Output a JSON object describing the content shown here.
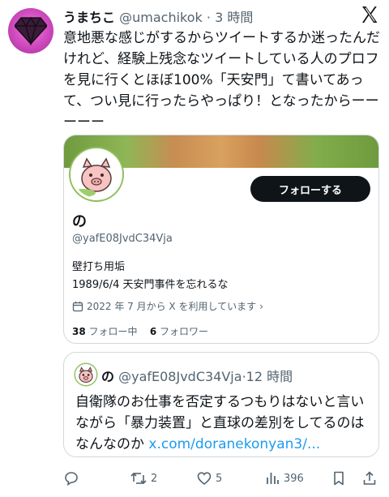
{
  "author": {
    "name": "うまちこ",
    "handle": "@umachikok",
    "dot": "·",
    "time": "3 時間"
  },
  "icons": {
    "platform": "x-logo-icon",
    "avatar": "diamond-icon",
    "calendar": "calendar-icon",
    "reply": "reply-icon",
    "retweet": "retweet-icon",
    "like": "heart-icon",
    "views": "views-icon",
    "bookmark": "bookmark-icon",
    "share": "share-icon"
  },
  "tweet": {
    "text": "意地悪な感じがするからツイートするか迷ったんだけれど、経験上残念なツイートしている人のプロフを見に行くとほぼ100%「天安門」て書いてあって、つい見に行ったらやっぱり！となったからーーーーー"
  },
  "profile_card": {
    "follow_label": "フォローする",
    "name": "の",
    "handle": "@yafE08JvdC34Vja",
    "bio": "壁打ち用垢\n1989/6/4 天安門事件を忘れるな",
    "joined": "2022 年 7 月から X を利用しています",
    "joined_chevron": "›",
    "following_count": "38",
    "following_label": "フォロー中",
    "followers_count": "6",
    "followers_label": "フォロワー"
  },
  "quote": {
    "name": "の",
    "handle": "@yafE08JvdC34Vja",
    "dot": "·",
    "time": "12 時間",
    "text": "自衛隊のお仕事を否定するつもりはないと言いながら「暴力装置」と直球の差別をしてるのはなんなのか ",
    "link": "x.com/doranekonyan3/..."
  },
  "actions": {
    "replies": "",
    "retweets": "2",
    "likes": "5",
    "views": "396"
  },
  "colors": {
    "accent": "#1d9bf0",
    "text": "#0f1419",
    "muted": "#536471",
    "border": "#cfd9de",
    "avatar_pink": "#d64fc4"
  }
}
